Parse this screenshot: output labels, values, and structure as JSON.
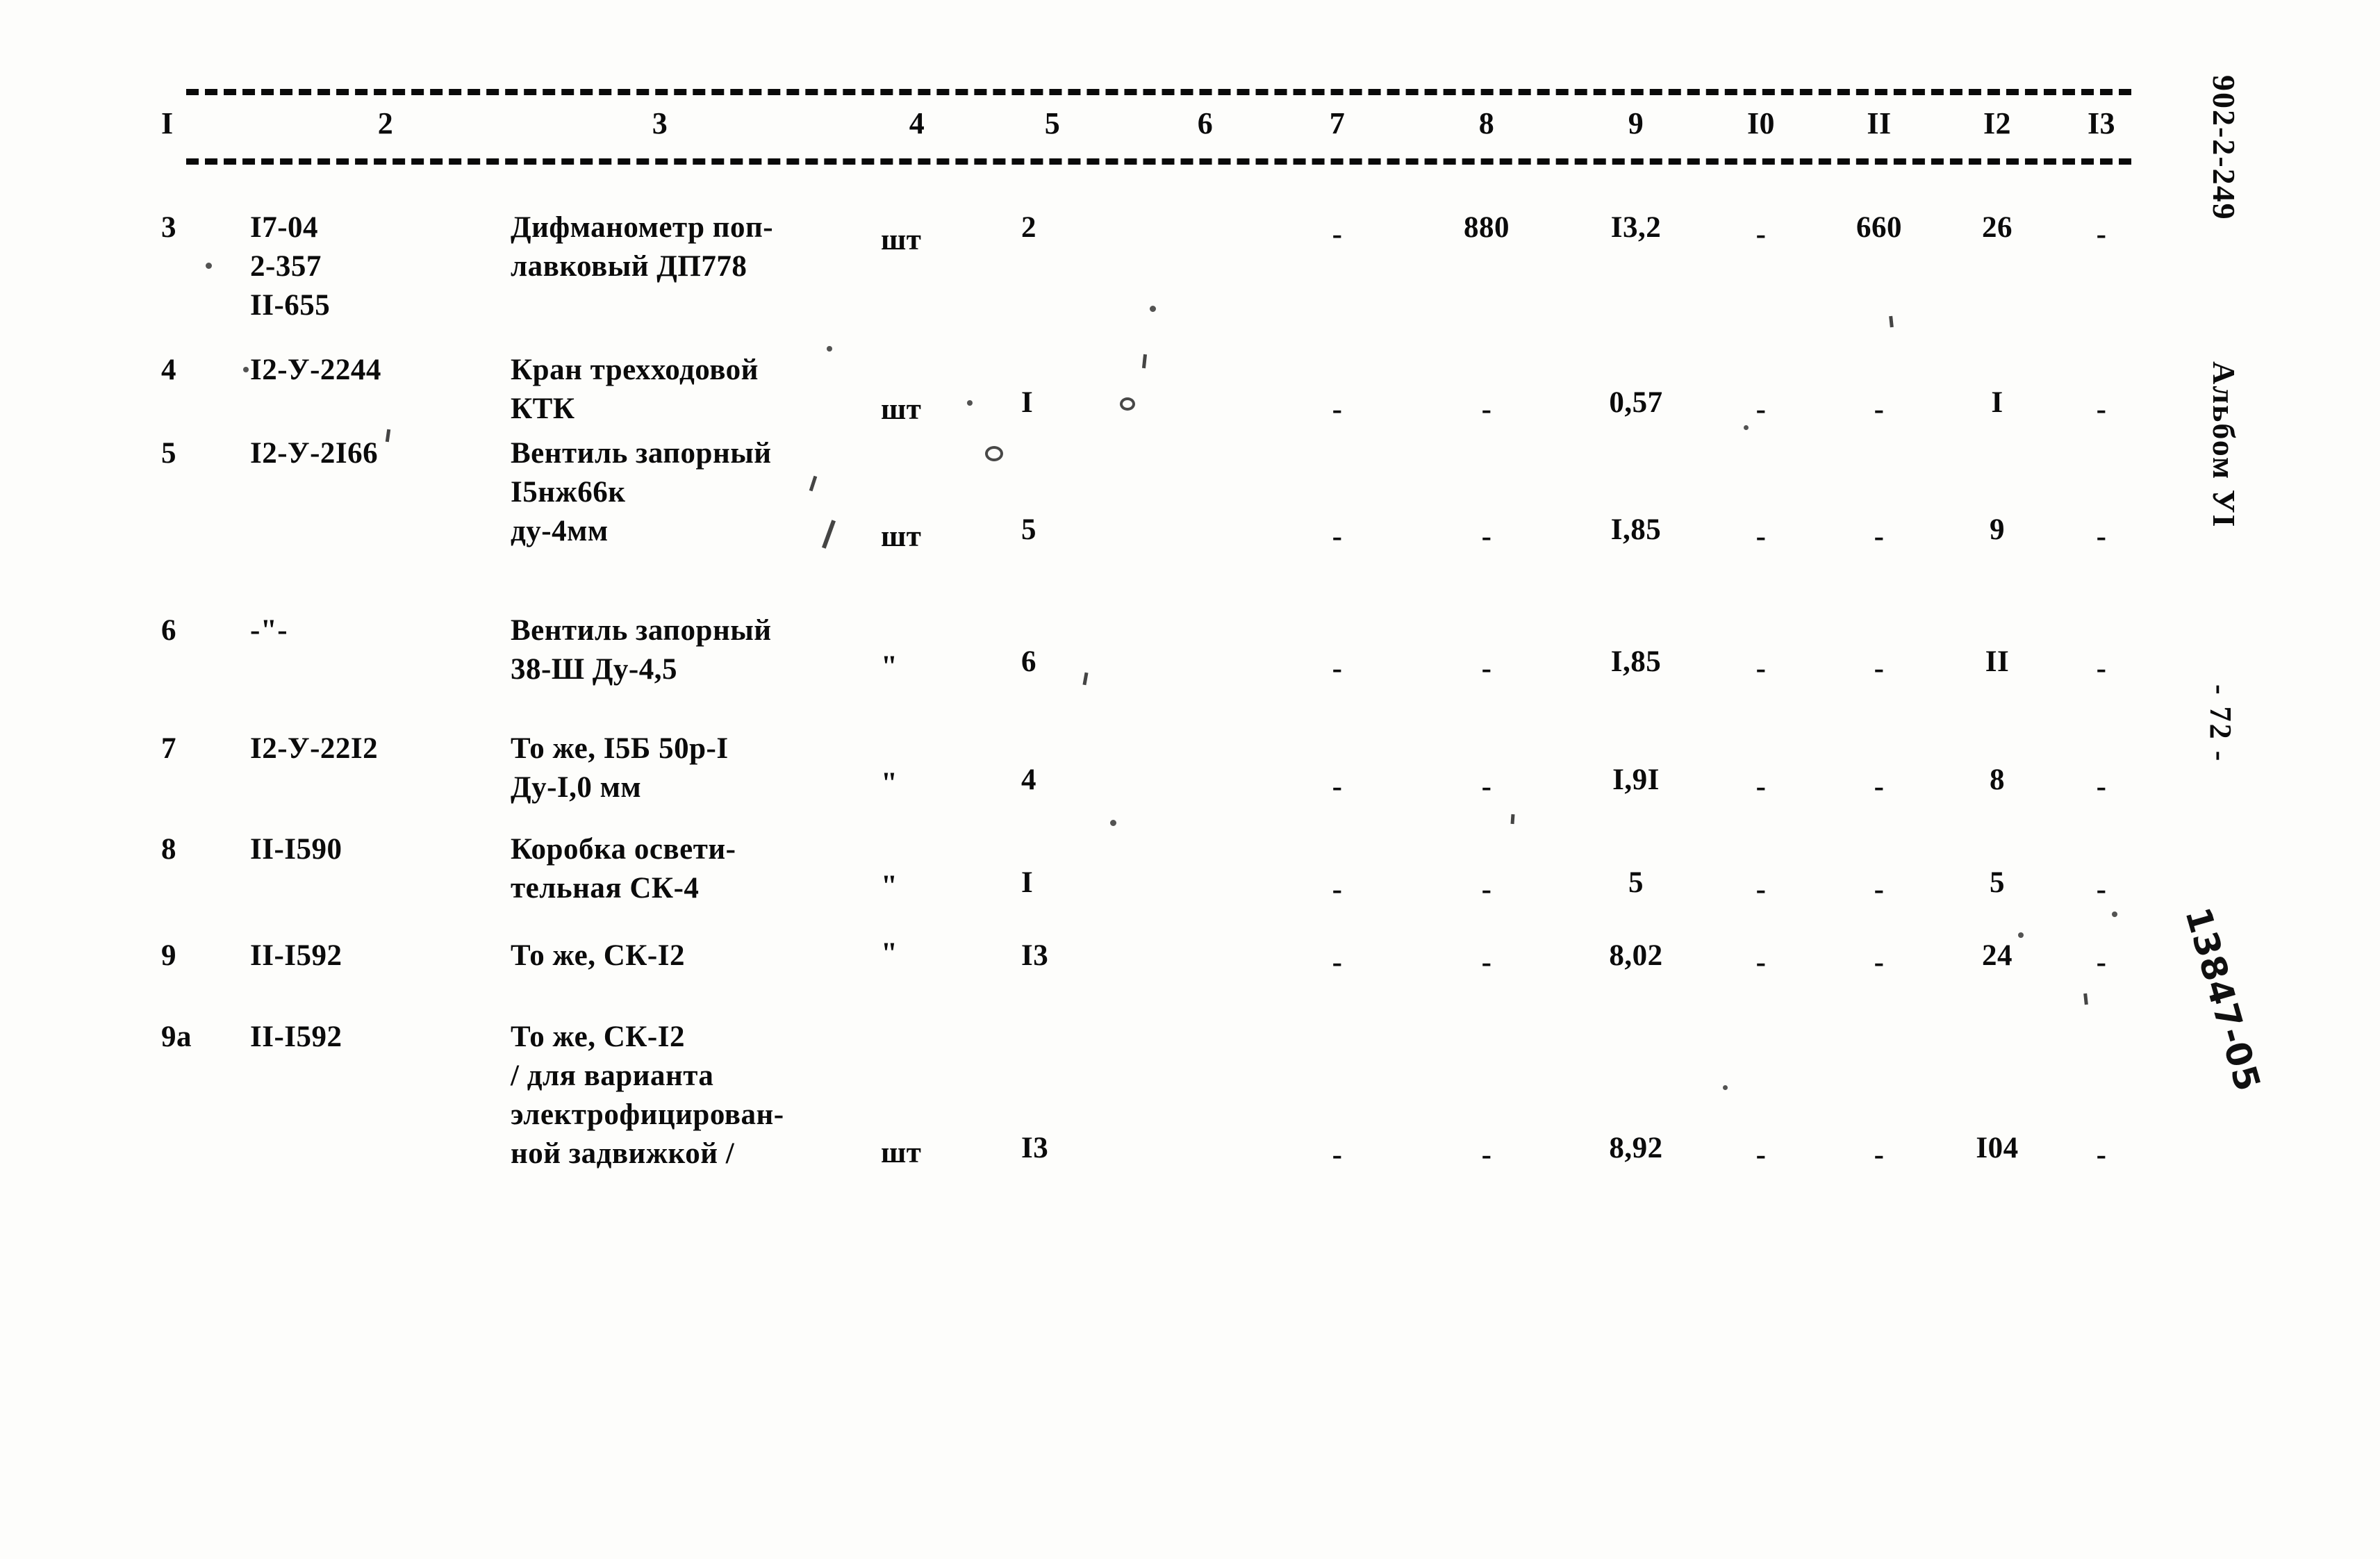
{
  "document": {
    "code_vertical": "902-2-249",
    "album_vertical": "Альбом УI",
    "page_number": "- 72 -",
    "archive_mark": "13847-05"
  },
  "table": {
    "header": [
      "I",
      "2",
      "3",
      "4",
      "5",
      "6",
      "7",
      "8",
      "9",
      "I0",
      "II",
      "I2",
      "I3"
    ],
    "rows": [
      {
        "num": "3",
        "code": "I7-04\n2-357\nII-655",
        "name": "Дифманометр поп-\nлавковый ДП778",
        "unit": "шт",
        "qty": "2",
        "c6": "",
        "c7": "-",
        "c8": "880",
        "c9": "I3,2",
        "c10": "-",
        "c11": "660",
        "c12": "26",
        "c13": "-"
      },
      {
        "num": "4",
        "code": "I2-У-2244",
        "name": "Кран трехходовой\nКТК",
        "unit": "шт",
        "qty": "I",
        "c6": "",
        "c7": "-",
        "c8": "-",
        "c9": "0,57",
        "c10": "-",
        "c11": "-",
        "c12": "I",
        "c13": "-"
      },
      {
        "num": "5",
        "code": "I2-У-2I66",
        "name": "Вентиль запорный\nI5нж66к\nду-4мм",
        "unit": "шт",
        "qty": "5",
        "c6": "",
        "c7": "-",
        "c8": "-",
        "c9": "I,85",
        "c10": "-",
        "c11": "-",
        "c12": "9",
        "c13": "-"
      },
      {
        "num": "6",
        "code": "-\"-",
        "name": "Вентиль запорный\n38-Ш Ду-4,5",
        "unit": "\"",
        "qty": "6",
        "c6": "",
        "c7": "-",
        "c8": "-",
        "c9": "I,85",
        "c10": "-",
        "c11": "-",
        "c12": "II",
        "c13": "-"
      },
      {
        "num": "7",
        "code": "I2-У-22I2",
        "name": "То же, I5Б 50р-I\nДу-I,0 мм",
        "unit": "\"",
        "qty": "4",
        "c6": "",
        "c7": "-",
        "c8": "-",
        "c9": "I,9I",
        "c10": "-",
        "c11": "-",
        "c12": "8",
        "c13": "-"
      },
      {
        "num": "8",
        "code": "II-I590",
        "name": "Коробка освети-\nтельная СК-4",
        "unit": "\"",
        "qty": "I",
        "c6": "",
        "c7": "-",
        "c8": "-",
        "c9": "5",
        "c10": "-",
        "c11": "-",
        "c12": "5",
        "c13": "-"
      },
      {
        "num": "9",
        "code": "II-I592",
        "name": "То же, СК-I2",
        "unit": "\"",
        "qty": "I3",
        "c6": "",
        "c7": "-",
        "c8": "-",
        "c9": "8,02",
        "c10": "-",
        "c11": "-",
        "c12": "24",
        "c13": "-"
      },
      {
        "num": "9а",
        "code": "II-I592",
        "name": "То же, СК-I2\n/ для варианта\nэлектрофицирован-\nной задвижкой /",
        "unit": "шт",
        "qty": "I3",
        "c6": "",
        "c7": "-",
        "c8": "-",
        "c9": "8,92",
        "c10": "-",
        "c11": "-",
        "c12": "I04",
        "c13": "-"
      }
    ]
  }
}
